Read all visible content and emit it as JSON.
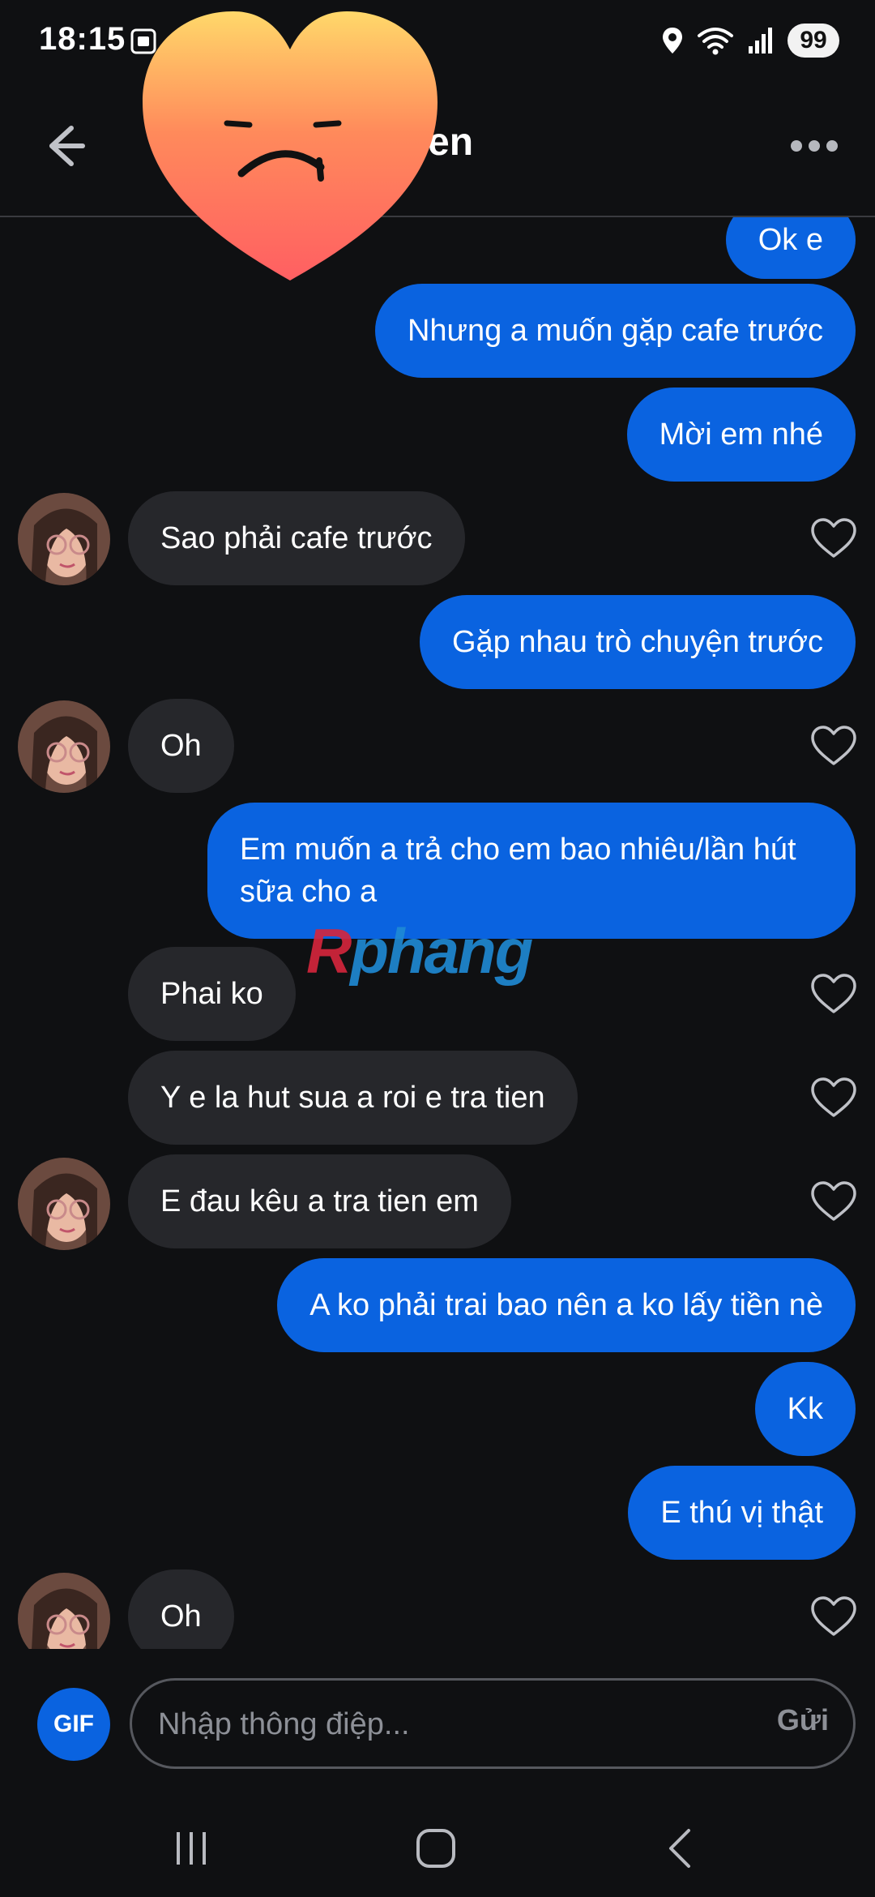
{
  "status_bar": {
    "time": "18:15",
    "battery": "99",
    "icons": [
      "screen-capture-icon",
      "location-icon",
      "wifi-icon",
      "signal-icon"
    ]
  },
  "header": {
    "title": "en",
    "back_icon": "arrow-left-icon",
    "more_icon": "more-horizontal-icon"
  },
  "messages": [
    {
      "side": "out",
      "text": "Ok e"
    },
    {
      "side": "out",
      "text": "Nhưng a muốn gặp cafe trước"
    },
    {
      "side": "out",
      "text": "Mời em nhé"
    },
    {
      "side": "in",
      "text": "Sao phải cafe trước"
    },
    {
      "side": "out",
      "text": "Gặp nhau trò chuyện trước"
    },
    {
      "side": "in",
      "text": "Oh"
    },
    {
      "side": "out",
      "text": "Em muốn a trả cho em bao nhiêu/lần hút sữa cho a"
    },
    {
      "side": "in",
      "text": "Phai ko"
    },
    {
      "side": "in",
      "text": "Y e la hut sua a roi e tra tien"
    },
    {
      "side": "in",
      "text": "E đau kêu a tra tien em"
    },
    {
      "side": "out",
      "text": "A ko phải trai bao nên a ko lấy tiền nè"
    },
    {
      "side": "out",
      "text": "Kk"
    },
    {
      "side": "out",
      "text": "E thú vị thật"
    },
    {
      "side": "in",
      "text": "Oh"
    }
  ],
  "watermark": {
    "first": "R",
    "rest": "phang"
  },
  "composer": {
    "gif_label": "GIF",
    "placeholder": "Nhập thông điệp...",
    "send_label": "Gửi"
  },
  "colors": {
    "background": "#0f1012",
    "outgoing_bubble": "#0a63e0",
    "incoming_bubble": "#26272b",
    "accent": "#0a63e0"
  }
}
